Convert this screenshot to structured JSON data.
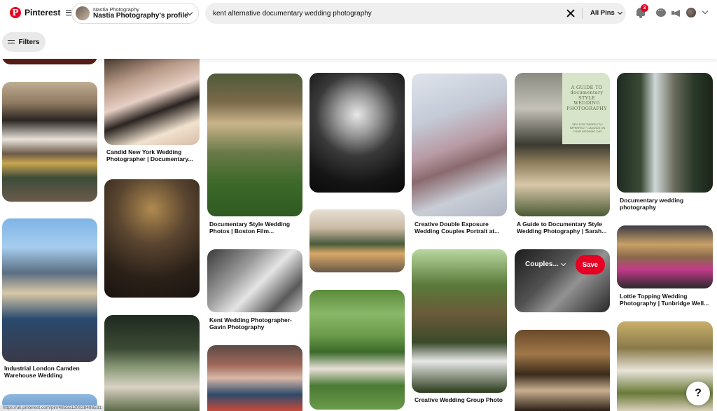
{
  "app": {
    "name": "Pinterest",
    "accent": "#e60023"
  },
  "profile": {
    "small": "Nastia Photography",
    "name": "Nastia Photography's profile"
  },
  "search": {
    "query": "kent alternative documentary wedding photography",
    "scope": "All Pins"
  },
  "notifications": {
    "count": "3"
  },
  "filters": {
    "label": "Filters"
  },
  "pins": [
    {
      "caption": ""
    },
    {
      "caption": ""
    },
    {
      "caption": "Industrial London Camden Warehouse Wedding"
    },
    {
      "caption": ""
    },
    {
      "caption": "Candid New York Wedding Photographer | Documentary..."
    },
    {
      "caption": ""
    },
    {
      "caption": ""
    },
    {
      "caption": "Documentary Style Wedding Photos | Boston Film..."
    },
    {
      "caption": "Kent Wedding Photographer- Gavin Photography"
    },
    {
      "caption": ""
    },
    {
      "caption": ""
    },
    {
      "caption": ""
    },
    {
      "caption": ""
    },
    {
      "caption": "Creative Double Exposure Wedding Couples Portrait at..."
    },
    {
      "caption": "Creative Wedding Group Photo"
    },
    {
      "caption": "A Guide to Documentary Style Wedding Photography | Sarah..."
    },
    {
      "caption": ""
    },
    {
      "caption": ""
    },
    {
      "caption": "Documentary wedding photography"
    },
    {
      "caption": "Lottie Topping Wedding Photography | Tunbridge Well..."
    },
    {
      "caption": ""
    }
  ],
  "hovered_pin": {
    "board": "Couples...",
    "save_label": "Save"
  },
  "guide_pin": {
    "title": "A GUIDE TO documentary STYLE WEDDING PHOTOGRAPHY",
    "subtitle": "TIPS FOR \"PERFECTLY IMPERFECT\" CANDIDS ON YOUR WEDDING DAY"
  },
  "help": {
    "label": "?"
  },
  "status_bar": {
    "url": "https://uk.pinterest.com/pin/48555120028486531"
  }
}
